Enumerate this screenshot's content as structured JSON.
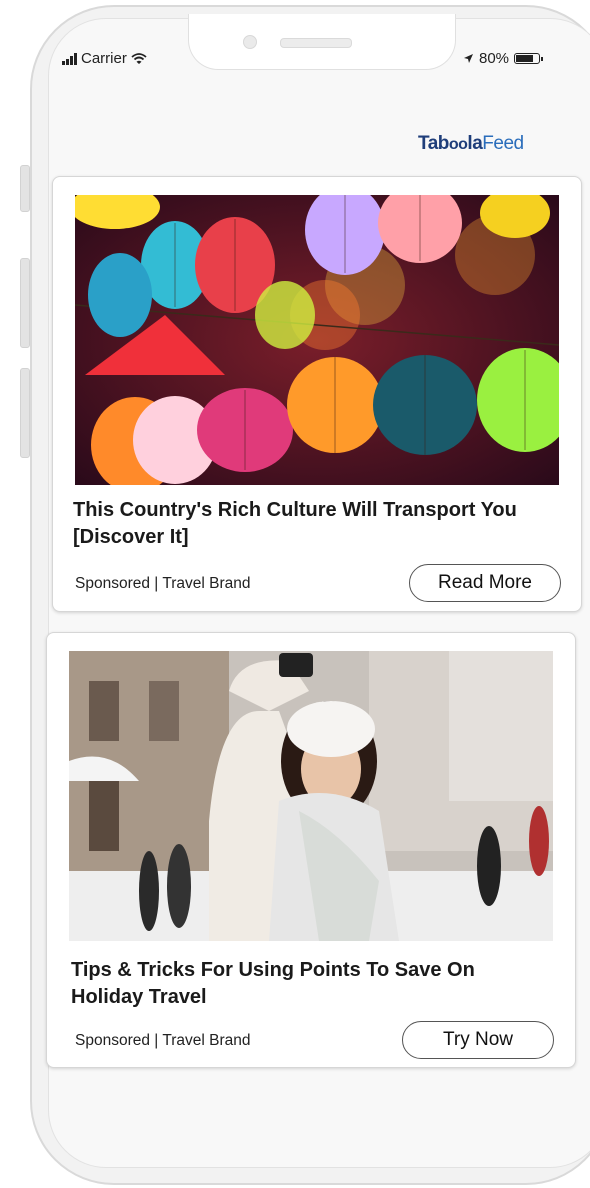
{
  "status_bar": {
    "carrier": "Carrier",
    "battery_percent": "80%",
    "battery_level": 0.8
  },
  "feed": {
    "brand_part1": "Tab",
    "brand_part2": "oo",
    "brand_part3": "la",
    "brand_part4": "Feed",
    "colors": {
      "brand_dark": "#1f3e7a",
      "brand_light": "#2a6dbb"
    }
  },
  "cards": [
    {
      "title": "This Country's Rich Culture Will Transport You [Discover It]",
      "meta": "Sponsored | Travel Brand",
      "cta": "Read More",
      "image_icon": "lanterns-photo"
    },
    {
      "title": "Tips & Tricks For Using Points To Save On Holiday Travel",
      "meta": "Sponsored | Travel Brand",
      "cta": "Try Now",
      "image_icon": "selfie-snow-photo"
    }
  ]
}
